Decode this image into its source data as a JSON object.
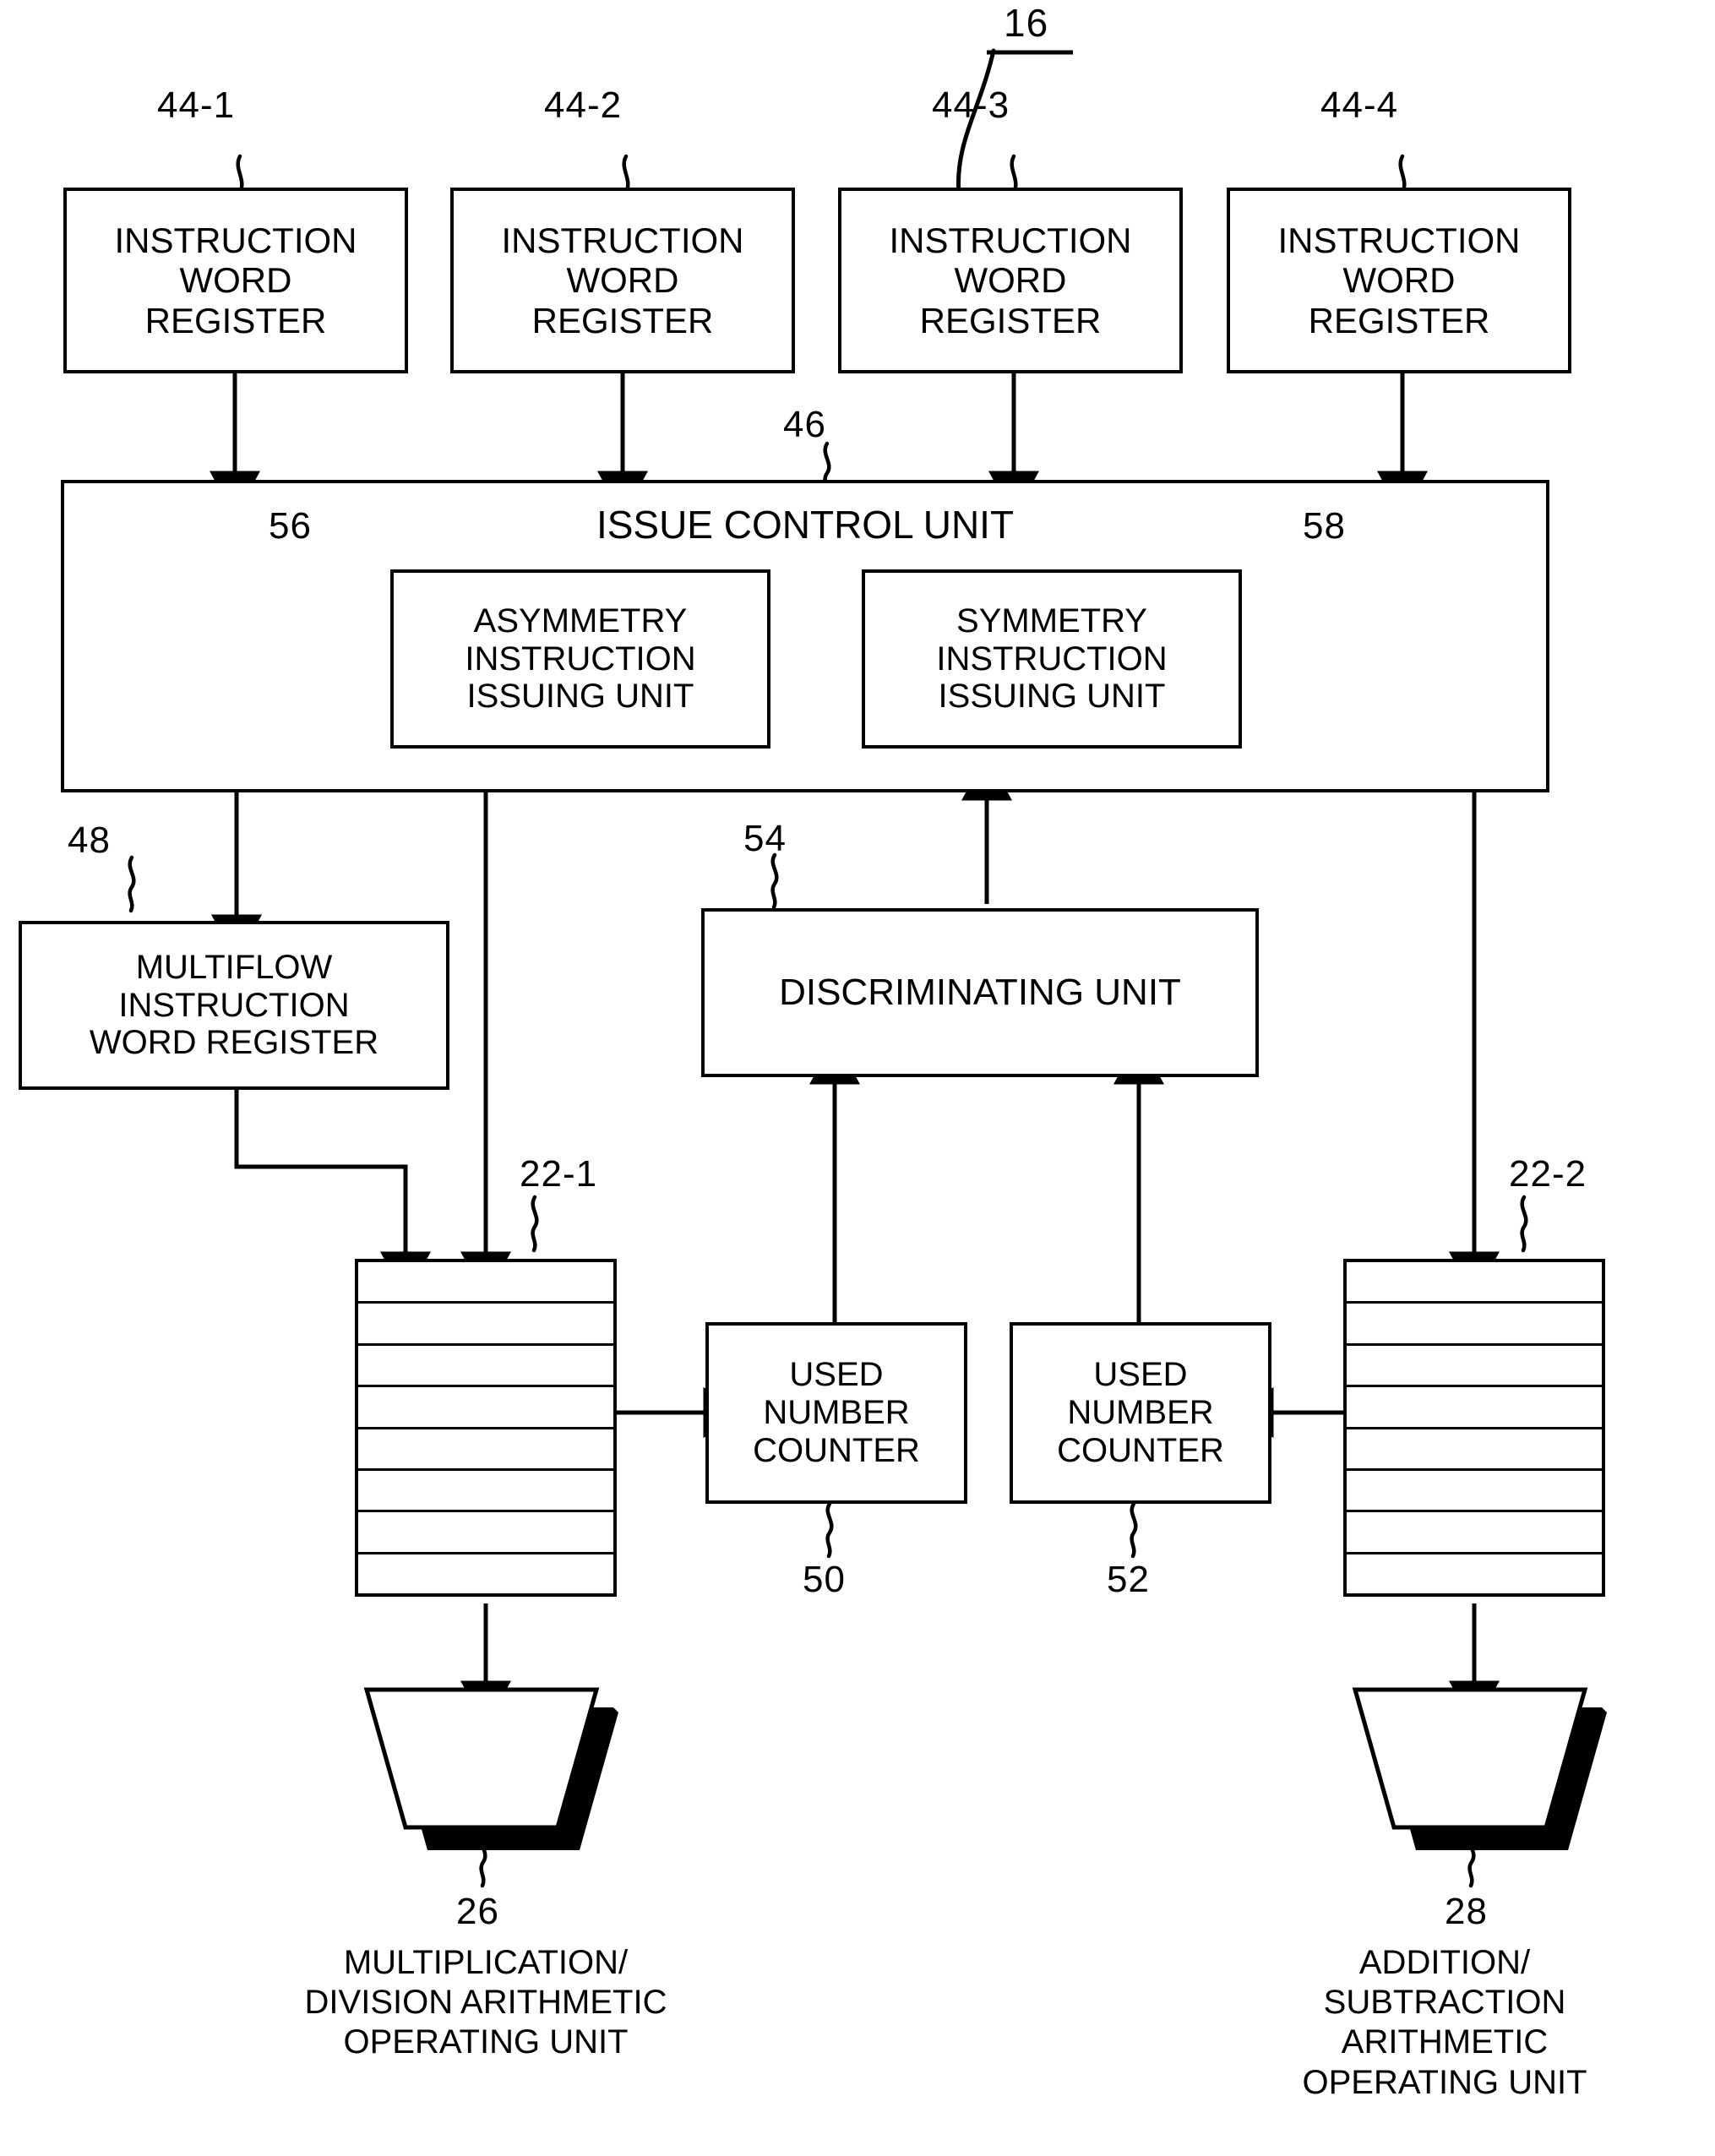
{
  "figure": {
    "overall_ref": "16"
  },
  "instruction_word_registers": [
    {
      "ref": "44-1",
      "line1": "INSTRUCTION",
      "line2": "WORD",
      "line3": "REGISTER"
    },
    {
      "ref": "44-2",
      "line1": "INSTRUCTION",
      "line2": "WORD",
      "line3": "REGISTER"
    },
    {
      "ref": "44-3",
      "line1": "INSTRUCTION",
      "line2": "WORD",
      "line3": "REGISTER"
    },
    {
      "ref": "44-4",
      "line1": "INSTRUCTION",
      "line2": "WORD",
      "line3": "REGISTER"
    }
  ],
  "issue_control_unit": {
    "ref": "46",
    "title": "ISSUE CONTROL UNIT",
    "children": [
      {
        "ref": "56",
        "line1": "ASYMMETRY",
        "line2": "INSTRUCTION",
        "line3": "ISSUING UNIT"
      },
      {
        "ref": "58",
        "line1": "SYMMETRY",
        "line2": "INSTRUCTION",
        "line3": "ISSUING UNIT"
      }
    ]
  },
  "multiflow_register": {
    "ref": "48",
    "line1": "MULTIFLOW",
    "line2": "INSTRUCTION",
    "line3": "WORD REGISTER"
  },
  "discriminating_unit": {
    "ref": "54",
    "title": "DISCRIMINATING UNIT"
  },
  "used_number_counters": [
    {
      "ref": "50",
      "line1": "USED",
      "line2": "NUMBER",
      "line3": "COUNTER"
    },
    {
      "ref": "52",
      "line1": "USED",
      "line2": "NUMBER",
      "line3": "COUNTER"
    }
  ],
  "register_stacks": [
    {
      "ref": "22-1",
      "rows": 8
    },
    {
      "ref": "22-2",
      "rows": 8
    }
  ],
  "arithmetic_units": [
    {
      "ref": "26",
      "caption_line1": "MULTIPLICATION/",
      "caption_line2": "DIVISION ARITHMETIC",
      "caption_line3": "OPERATING UNIT"
    },
    {
      "ref": "28",
      "caption_line1": "ADDITION/",
      "caption_line2": "SUBTRACTION",
      "caption_line3": "ARITHMETIC",
      "caption_line4": "OPERATING UNIT"
    }
  ],
  "colors": {
    "ink": "#000000",
    "paper": "#ffffff"
  }
}
